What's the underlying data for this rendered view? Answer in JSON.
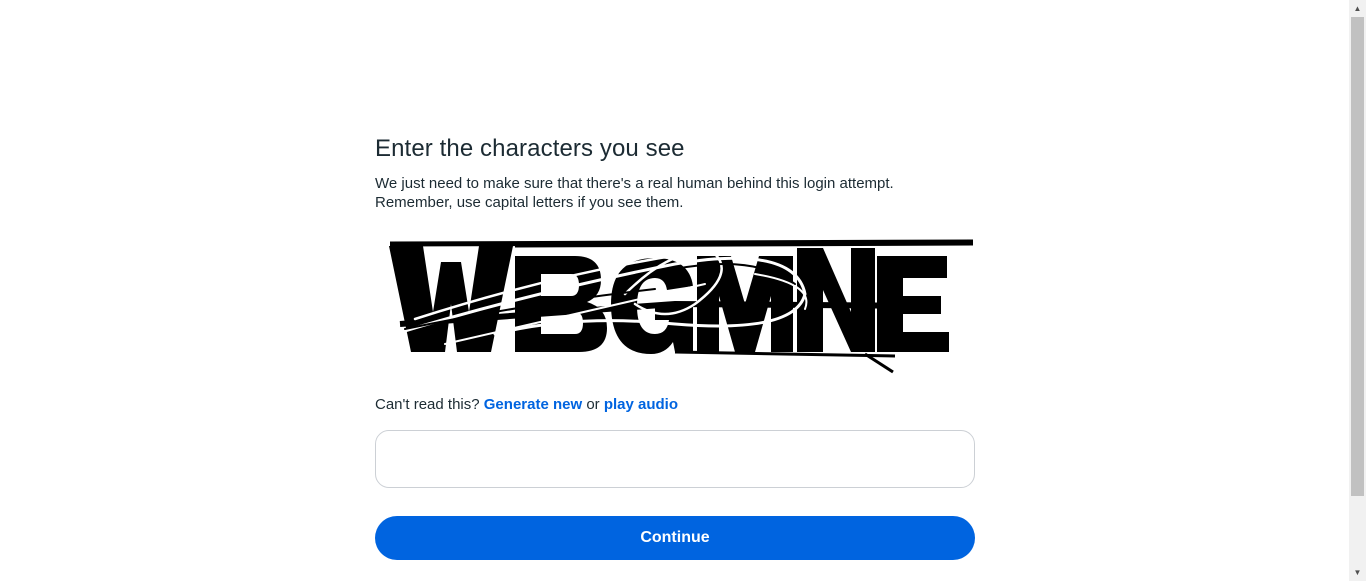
{
  "page": {
    "title": "Enter the characters you see",
    "description_line1": "We just need to make sure that there's a real human behind this login attempt.",
    "description_line2": "Remember, use capital letters if you see them.",
    "captcha_text": "WBGMNE"
  },
  "help": {
    "prefix": "Can't read this?",
    "generate_new": "Generate new",
    "or": "or",
    "play_audio": "play audio"
  },
  "input": {
    "value": "",
    "placeholder": ""
  },
  "buttons": {
    "continue": "Continue"
  },
  "colors": {
    "accent": "#0064e0",
    "text": "#1c2b33",
    "input_border": "#ccd0d5"
  }
}
